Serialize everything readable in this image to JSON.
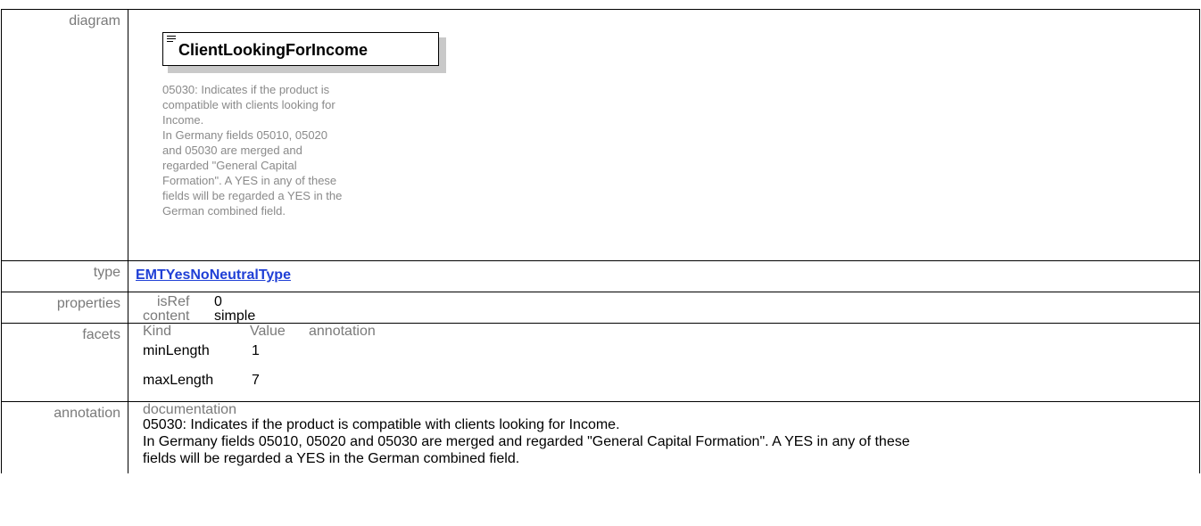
{
  "labels": {
    "diagram": "diagram",
    "type": "type",
    "properties": "properties",
    "facets": "facets",
    "annotation": "annotation"
  },
  "diagram": {
    "element_name": "ClientLookingForIncome",
    "element_doc": "05030: Indicates if the product is\ncompatible with clients looking for\nIncome.\nIn Germany fields 05010, 05020\nand 05030 are merged and\nregarded \"General Capital\nFormation\". A YES in any of these\nfields will be regarded a YES in the\nGerman combined field."
  },
  "type": {
    "link_text": "EMTYesNoNeutralType"
  },
  "properties": {
    "items": [
      {
        "key": "isRef",
        "value": "0"
      },
      {
        "key": "content",
        "value": "simple"
      }
    ]
  },
  "facets": {
    "headers": [
      "Kind",
      "Value",
      "annotation"
    ],
    "rows": [
      {
        "kind": "minLength",
        "value": "1"
      },
      {
        "kind": "maxLength",
        "value": "7"
      }
    ]
  },
  "annotation": {
    "heading": "documentation",
    "text": "05030: Indicates if the product is compatible with clients looking for Income.\nIn Germany fields 05010, 05020 and 05030 are merged and regarded \"General Capital Formation\". A YES in any of these\nfields will be regarded a YES in the German combined field."
  }
}
